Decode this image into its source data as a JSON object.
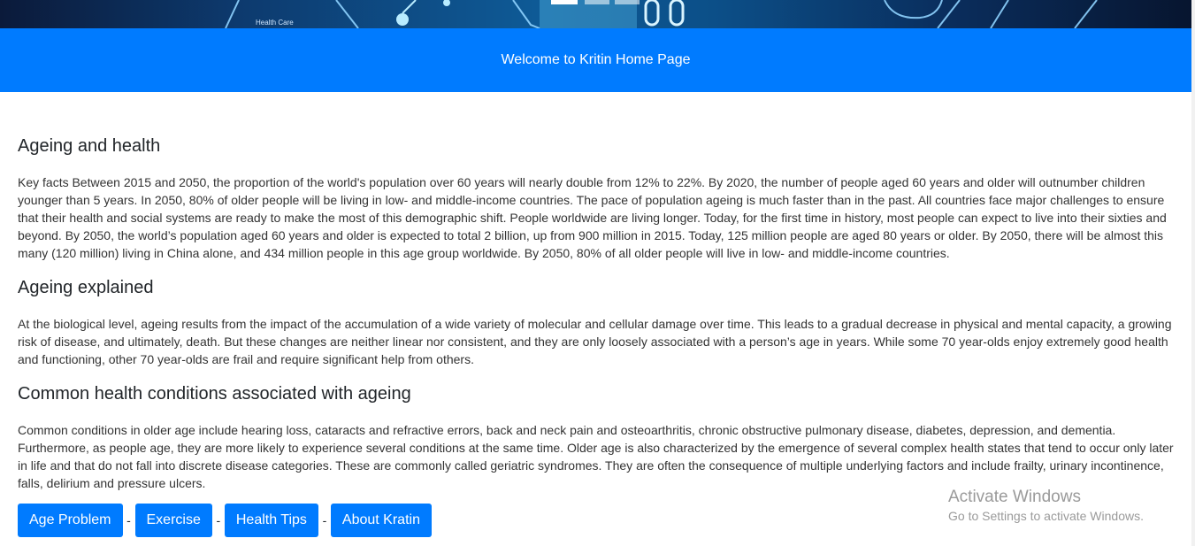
{
  "banner": {
    "caption": "Health Care"
  },
  "header": {
    "welcome": "Welcome to Kritin Home Page",
    "background_color": "#007bff"
  },
  "sections": [
    {
      "title": "Ageing and health",
      "body": "Key facts Between 2015 and 2050, the proportion of the world's population over 60 years will nearly double from 12% to 22%. By 2020, the number of people aged 60 years and older will outnumber children younger than 5 years. In 2050, 80% of older people will be living in low- and middle-income countries. The pace of population ageing is much faster than in the past. All countries face major challenges to ensure that their health and social systems are ready to make the most of this demographic shift. People worldwide are living longer. Today, for the first time in history, most people can expect to live into their sixties and beyond. By 2050, the world’s population aged 60 years and older is expected to total 2 billion, up from 900 million in 2015. Today, 125 million people are aged 80 years or older. By 2050, there will be almost this many (120 million) living in China alone, and 434 million people in this age group worldwide. By 2050, 80% of all older people will live in low- and middle-income countries."
    },
    {
      "title": "Ageing explained",
      "body": "At the biological level, ageing results from the impact of the accumulation of a wide variety of molecular and cellular damage over time. This leads to a gradual decrease in physical and mental capacity, a growing risk of disease, and ultimately, death. But these changes are neither linear nor consistent, and they are only loosely associated with a person’s age in years. While some 70 year-olds enjoy extremely good health and functioning, other 70 year-olds are frail and require significant help from others."
    },
    {
      "title": "Common health conditions associated with ageing",
      "body": "Common conditions in older age include hearing loss, cataracts and refractive errors, back and neck pain and osteoarthritis, chronic obstructive pulmonary disease, diabetes, depression, and dementia. Furthermore, as people age, they are more likely to experience several conditions at the same time. Older age is also characterized by the emergence of several complex health states that tend to occur only later in life and that do not fall into discrete disease categories. These are commonly called geriatric syndromes. They are often the consequence of multiple underlying factors and include frailty, urinary incontinence, falls, delirium and pressure ulcers."
    }
  ],
  "nav": {
    "buttons": [
      "Age Problem",
      "Exercise",
      "Health Tips",
      "About Kratin"
    ],
    "separator": "-"
  },
  "watermark": {
    "title": "Activate Windows",
    "subtitle": "Go to Settings to activate Windows."
  }
}
